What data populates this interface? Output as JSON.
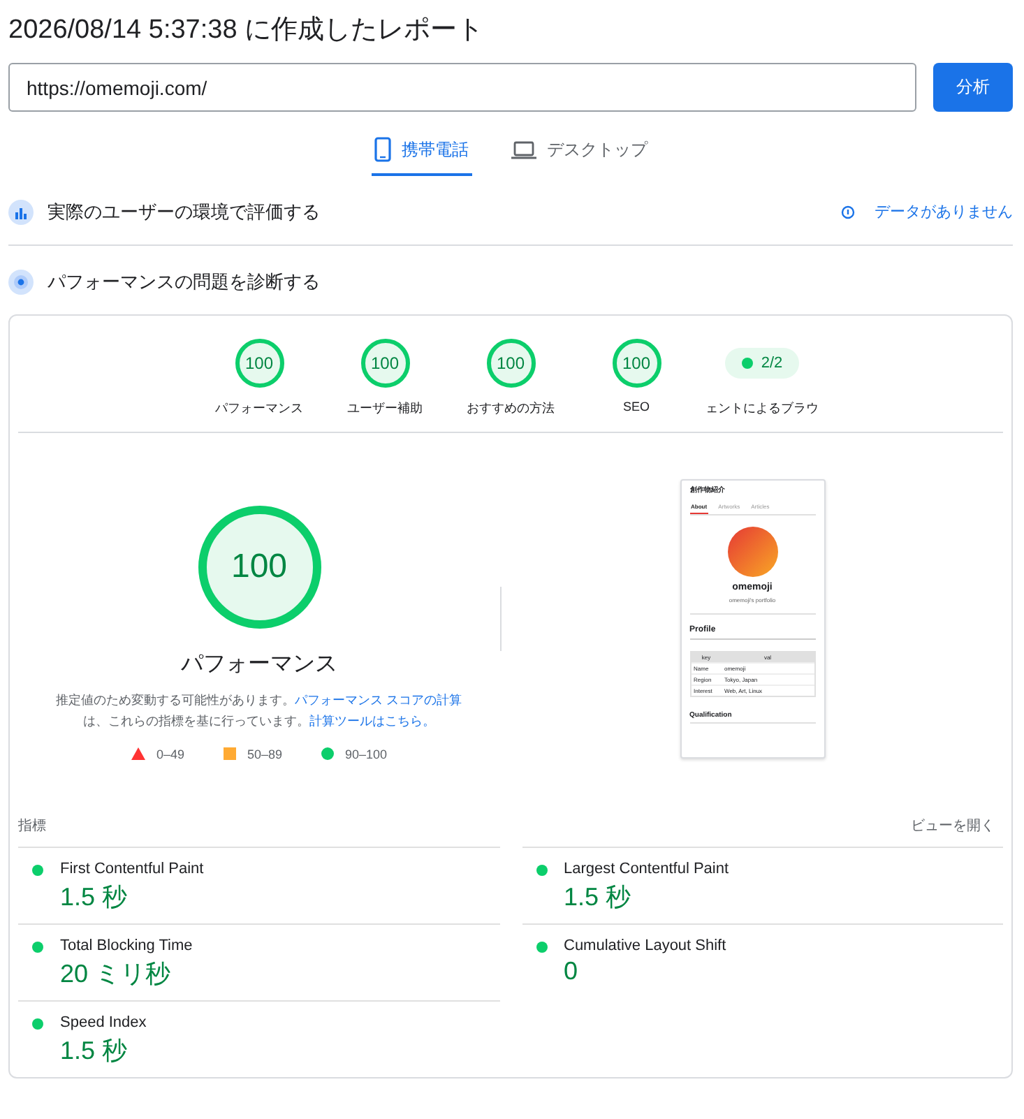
{
  "report_title": "2026/08/14 5:37:38 に作成したレポート",
  "url_field": {
    "value": "https://omemoji.com/"
  },
  "analyze_button": "分析",
  "device_tabs": [
    {
      "kind": "mobile",
      "label": "携帯電話",
      "selected": true
    },
    {
      "kind": "desktop",
      "label": "デスクトップ",
      "selected": false
    }
  ],
  "field_section": {
    "title": "実際のユーザーの環境で評価する",
    "status": "データがありません"
  },
  "lab_section": {
    "title": "パフォーマンスの問題を診断する"
  },
  "category_scores": [
    {
      "kind": "gauge",
      "score": "100",
      "level": 1,
      "label": "パフォーマンス"
    },
    {
      "kind": "gauge",
      "score": "100",
      "level": 1,
      "label": "ユーザー補助"
    },
    {
      "kind": "gauge",
      "score": "100",
      "level": 1,
      "label": "おすすめの方法"
    },
    {
      "kind": "gauge",
      "score": "100",
      "level": 1,
      "label": "SEO"
    },
    {
      "kind": "pill",
      "score": "2/2",
      "label": "ェントによるブラウ"
    }
  ],
  "main_gauge": {
    "score": "100",
    "level": 1,
    "title": "パフォーマンス",
    "note_text_1": "推定値のため変動する可能性があります。",
    "note_link_1": "パフォーマンス スコアの計算",
    "note_text_2": "は、これらの指標を基に行っています。",
    "note_link_2": "計算ツールはこちら。"
  },
  "legend": [
    {
      "kind": "fail",
      "range": "0–49"
    },
    {
      "kind": "average",
      "range": "50–89"
    },
    {
      "kind": "pass",
      "range": "90–100"
    }
  ],
  "page_screenshot": {
    "site_title": "創作物紹介",
    "tabs": [
      {
        "label": "About",
        "selected": true
      },
      {
        "label": "Artworks",
        "selected": false
      },
      {
        "label": "Articles",
        "selected": false
      }
    ],
    "name": "omemoji",
    "subtitle": "omemoji's portfolio",
    "profile_heading": "Profile",
    "table_columns": [
      "key",
      "val"
    ],
    "table_rows": [
      [
        "Name",
        "omemoji"
      ],
      [
        "Region",
        "Tokyo, Japan"
      ],
      [
        "Interest",
        "Web, Art, Linux"
      ]
    ],
    "qualification_heading": "Qualification"
  },
  "metrics_header": {
    "label": "指標",
    "toggle": "ビューを開く"
  },
  "metrics": [
    {
      "name": "First Contentful Paint",
      "value": "1.5 秒",
      "color": "#0cce6b"
    },
    {
      "name": "Largest Contentful Paint",
      "value": "1.5 秒",
      "color": "#0cce6b"
    },
    {
      "name": "Total Blocking Time",
      "value": "20 ミリ秒",
      "color": "#0cce6b"
    },
    {
      "name": "Cumulative Layout Shift",
      "value": "0",
      "color": "#0cce6b"
    },
    {
      "name": "Speed Index",
      "value": "1.5 秒",
      "color": "#0cce6b"
    }
  ]
}
